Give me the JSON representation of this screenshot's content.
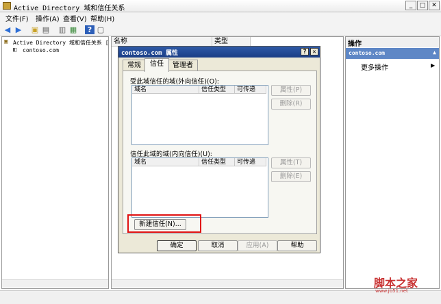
{
  "window": {
    "title": "Active Directory 域和信任关系",
    "controls": [
      "_",
      "□",
      "✕"
    ]
  },
  "menu": [
    "文件(F)",
    "操作(A)",
    "查看(V)",
    "帮助(H)"
  ],
  "tree": {
    "root": "Active Directory 域和信任关系 [",
    "child": "contoso.com"
  },
  "list": {
    "columns": [
      "名称",
      "类型"
    ]
  },
  "actions": {
    "header": "操作",
    "section": "contoso.com",
    "section_arrow": "▲",
    "more": "更多操作",
    "more_arrow": "▶"
  },
  "dialog": {
    "title": "contoso.com 属性",
    "help_btn": "?",
    "close_btn": "✕",
    "tabs": [
      "常规",
      "信任",
      "管理者"
    ],
    "active_tab": "信任",
    "outgoing": {
      "label": "受此域信任的域(外向信任)(O):",
      "columns": [
        "域名",
        "信任类型",
        "可传递"
      ],
      "properties": "属性(P)",
      "remove": "删除(R)"
    },
    "incoming": {
      "label": "信任此域的域(内向信任)(U):",
      "columns": [
        "域名",
        "信任类型",
        "可传递"
      ],
      "properties": "属性(T)",
      "remove": "删除(E)"
    },
    "new_trust": "新建信任(N)...",
    "ok": "确定",
    "cancel": "取消",
    "apply": "应用(A)",
    "help": "帮助"
  },
  "watermark": {
    "text": "脚本之家",
    "url": "www.jb51.net"
  },
  "colors": {
    "dialog_title": "#1a3d86",
    "action_section": "#5e87c6",
    "highlight": "#e01010"
  }
}
